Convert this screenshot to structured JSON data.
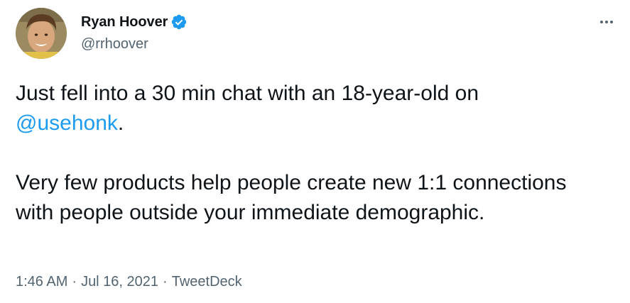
{
  "author": {
    "display_name": "Ryan Hoover",
    "handle": "@rrhoover",
    "verified": true
  },
  "tweet": {
    "line1_before": "Just fell into a 30 min chat with an 18-year-old on",
    "mention": "@usehonk",
    "line1_after": ".",
    "paragraph2": "Very few products help people create new 1:1 connections with people outside your immediate demographic."
  },
  "meta": {
    "time": "1:46 AM",
    "separator": "·",
    "date": "Jul 16, 2021",
    "source": "TweetDeck"
  },
  "icons": {
    "verified": "verified-badge-icon",
    "more": "more-options-icon"
  },
  "colors": {
    "accent": "#1d9bf0",
    "text": "#0f1419",
    "secondary": "#536471"
  }
}
